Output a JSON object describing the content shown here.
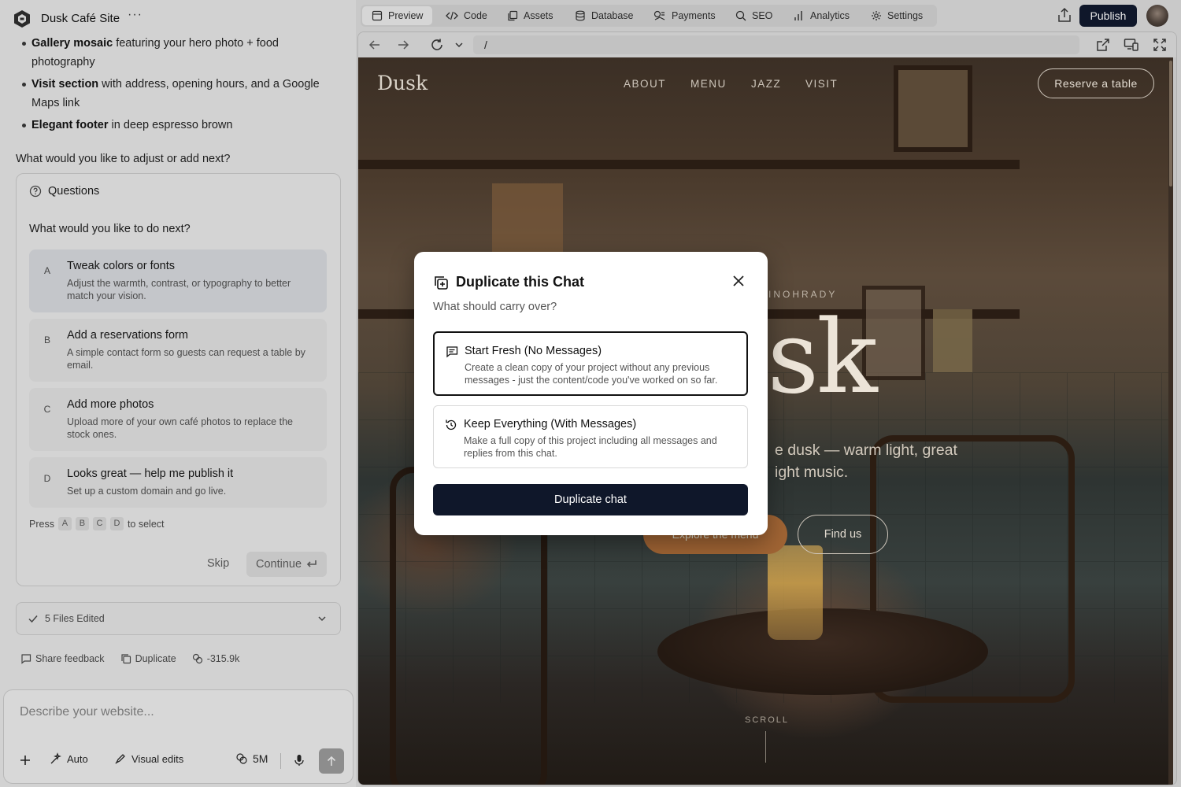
{
  "app": {
    "project_title": "Dusk Café Site",
    "more_label": "···"
  },
  "chat": {
    "bullets": [
      {
        "bold": "Gallery mosaic",
        "rest": " featuring your hero photo + food photography"
      },
      {
        "bold": "Visit section",
        "rest": " with address, opening hours, and a Google Maps link"
      },
      {
        "bold": "Elegant footer",
        "rest": " in deep espresso brown"
      }
    ],
    "ask": "What would you like to adjust or add next?",
    "questions": {
      "title": "Questions",
      "prompt": "What would you like to do next?",
      "options": [
        {
          "key": "A",
          "title": "Tweak colors or fonts",
          "desc": "Adjust the warmth, contrast, or typography to better match your vision."
        },
        {
          "key": "B",
          "title": "Add a reservations form",
          "desc": "A simple contact form so guests can request a table by email."
        },
        {
          "key": "C",
          "title": "Add more photos",
          "desc": "Upload more of your own café photos to replace the stock ones."
        },
        {
          "key": "D",
          "title": "Looks great — help me publish it",
          "desc": "Set up a custom domain and go live."
        }
      ],
      "press_label": "Press",
      "press_keys": [
        "A",
        "B",
        "C",
        "D"
      ],
      "to_select": "to select",
      "skip": "Skip",
      "continue": "Continue"
    },
    "files_edited": "5 Files Edited",
    "actions": {
      "share_feedback": "Share feedback",
      "duplicate": "Duplicate",
      "tokens": "-315.9k"
    },
    "composer": {
      "placeholder": "Describe your website...",
      "auto": "Auto",
      "visual_edits": "Visual edits",
      "credits": "5M"
    }
  },
  "topnav": {
    "tabs": [
      {
        "label": "Preview",
        "icon": "browser-icon",
        "active": true
      },
      {
        "label": "Code",
        "icon": "code-icon"
      },
      {
        "label": "Assets",
        "icon": "assets-icon"
      },
      {
        "label": "Database",
        "icon": "database-icon"
      },
      {
        "label": "Payments",
        "icon": "payments-icon"
      },
      {
        "label": "SEO",
        "icon": "search-icon"
      },
      {
        "label": "Analytics",
        "icon": "analytics-icon"
      },
      {
        "label": "Settings",
        "icon": "gear-icon"
      }
    ],
    "publish": "Publish"
  },
  "browser": {
    "url": "/"
  },
  "site": {
    "brand": "Dusk",
    "nav": [
      "ABOUT",
      "MENU",
      "JAZZ",
      "VISIT"
    ],
    "reserve": "Reserve a table",
    "eyebrow": "INOHRADY",
    "hero": "usk",
    "tagline_1": "e dusk — warm light, great",
    "tagline_2": "ight music.",
    "explore": "Explore the menu",
    "find_us": "Find us",
    "scroll": "SCROLL"
  },
  "modal": {
    "title": "Duplicate this Chat",
    "subtitle": "What should carry over?",
    "options": [
      {
        "title": "Start Fresh (No Messages)",
        "desc": "Create a clean copy of your project without any previous messages - just the content/code you've worked on so far.",
        "icon": "message-icon",
        "selected": true
      },
      {
        "title": "Keep Everything (With Messages)",
        "desc": "Make a full copy of this project including all messages and replies from this chat.",
        "icon": "history-icon",
        "selected": false
      }
    ],
    "button": "Duplicate chat"
  },
  "colors": {
    "primary_dark": "#0f172a",
    "accent_copper": "#a06434"
  }
}
